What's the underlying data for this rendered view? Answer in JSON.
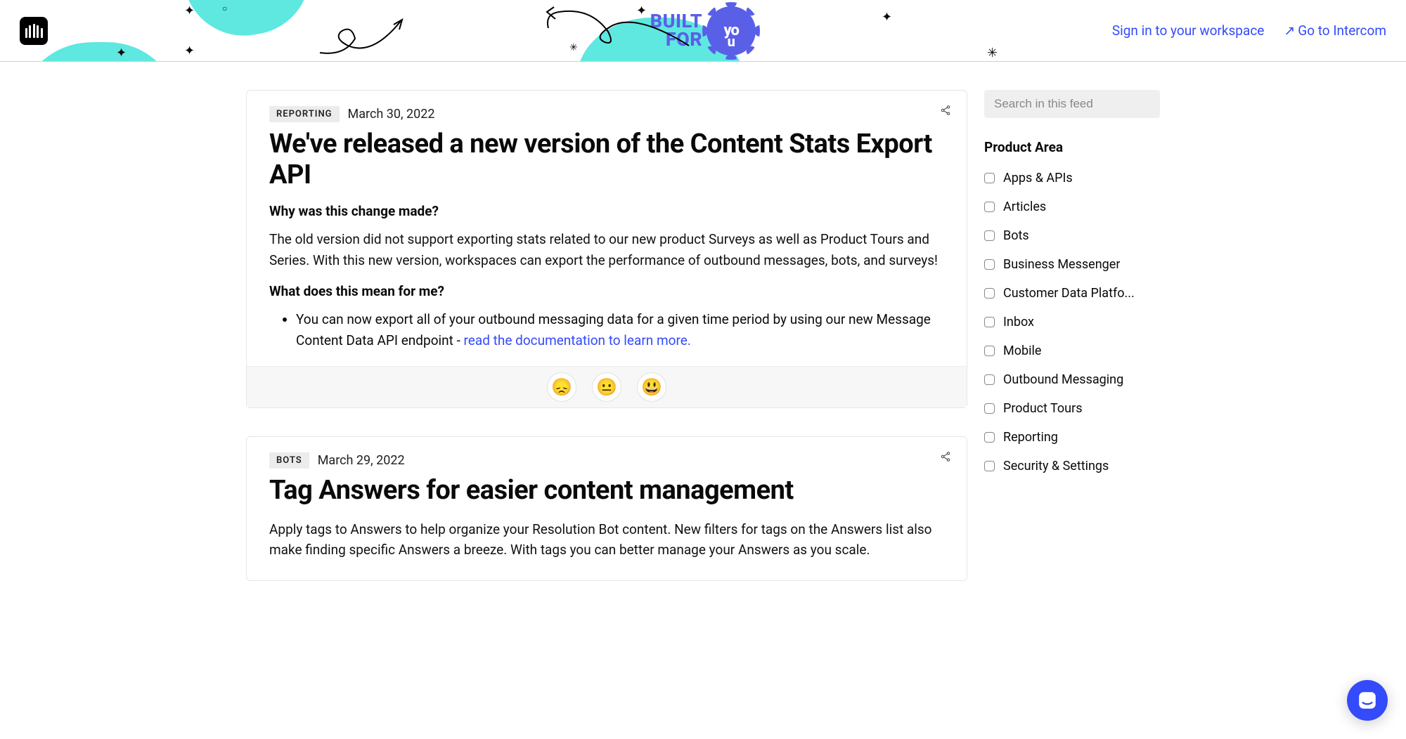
{
  "header": {
    "built_line1": "BUILT",
    "built_line2": "FOR",
    "splat_top": "yo",
    "splat_bottom": "u",
    "signin": "Sign in to your workspace",
    "goto": "Go to Intercom"
  },
  "search": {
    "placeholder": "Search in this feed"
  },
  "sidebar": {
    "heading": "Product Area",
    "filters": [
      "Apps & APIs",
      "Articles",
      "Bots",
      "Business Messenger",
      "Customer Data Platfo...",
      "Inbox",
      "Mobile",
      "Outbound Messaging",
      "Product Tours",
      "Reporting",
      "Security & Settings"
    ]
  },
  "posts": [
    {
      "tag": "REPORTING",
      "date": "March 30, 2022",
      "title": "We've released a new version of the Content Stats Export API",
      "h_why": "Why was this change made?",
      "p_why": "The old version did not support exporting stats related to our new product Surveys as well as Product Tours and Series. With this new version, workspaces can export the performance of outbound messages, bots, and surveys!",
      "h_mean": "What does this mean for me?",
      "bullet_prefix": "You can now export all of your outbound messaging data for a given time period by using our new Message Content Data API endpoint - ",
      "bullet_link": "read the documentation to learn more."
    },
    {
      "tag": "BOTS",
      "date": "March 29, 2022",
      "title": "Tag Answers for easier content management",
      "p": "Apply tags to Answers to help organize your Resolution Bot content. New filters for tags on the Answers list also make finding specific Answers a breeze. With tags you can better manage your Answers as you scale."
    }
  ],
  "reactions": {
    "sad": "😞",
    "neutral": "😐",
    "happy": "😃"
  }
}
